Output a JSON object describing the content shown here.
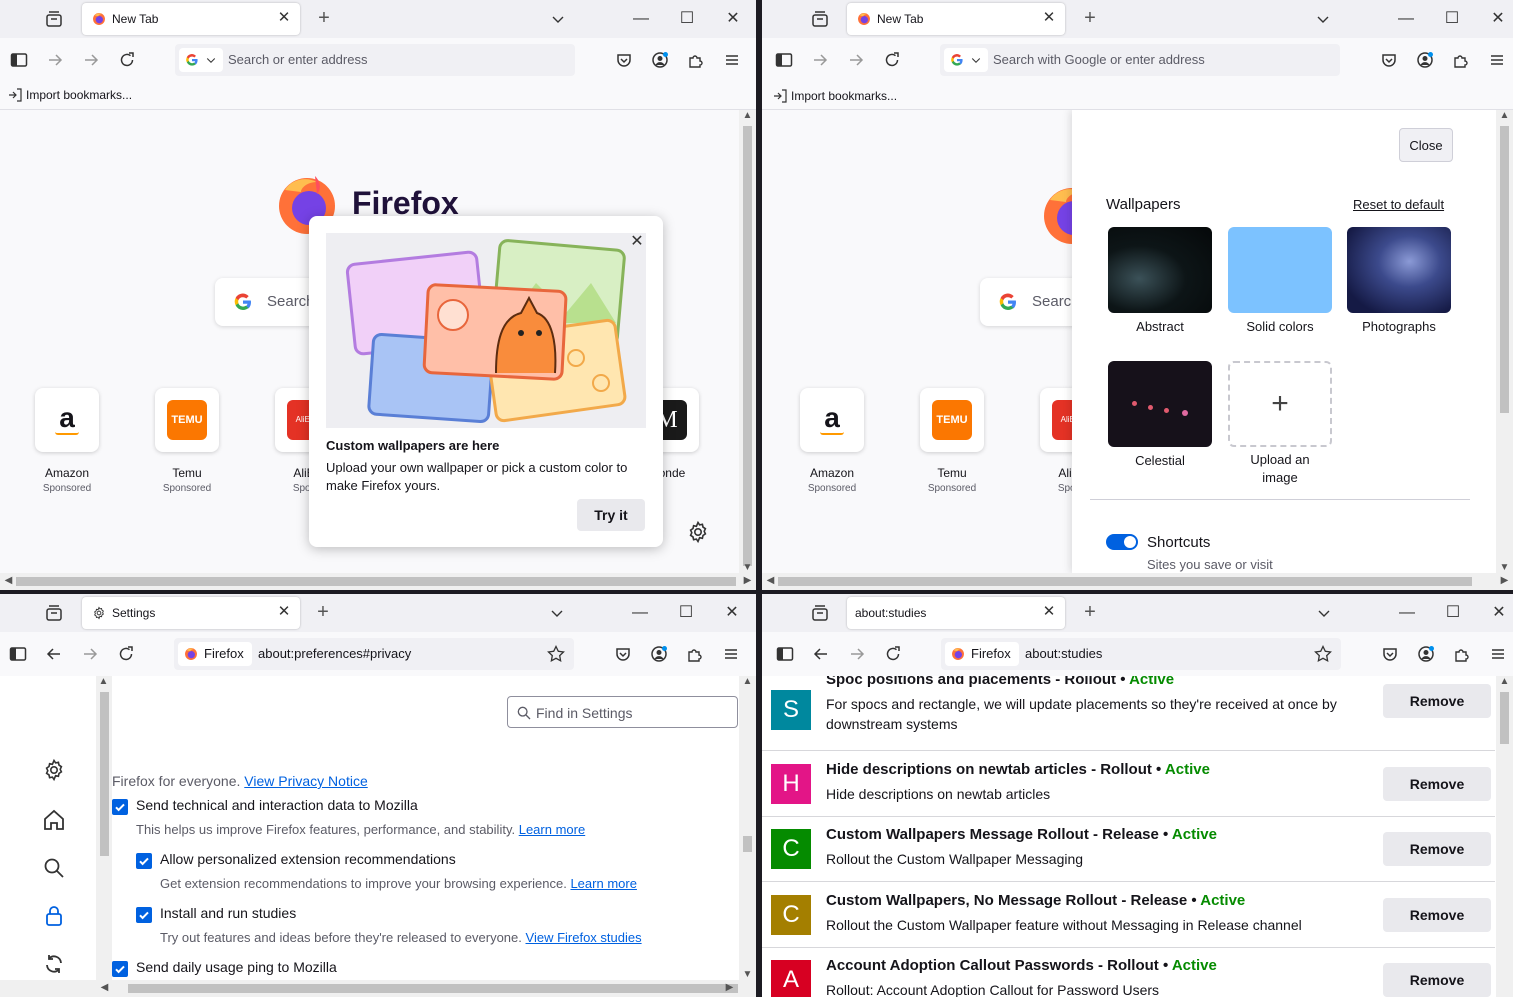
{
  "colors": {
    "accent": "#0061e0",
    "active": "#058b00"
  },
  "icons": {
    "tablist": "tab-list-icon",
    "sidebar": "sidebar-icon",
    "back": "back-arrow-icon",
    "forward": "forward-arrow-icon",
    "reload": "reload-icon",
    "pocket": "pocket-icon",
    "account": "account-icon",
    "extensions": "puzzle-icon",
    "menu": "hamburger-icon"
  },
  "window_controls": {
    "minimize": "—",
    "maximize": "☐",
    "close": "✕"
  },
  "win1": {
    "tab_title": "New Tab",
    "search_placeholder": "Search or enter address",
    "import_bookmarks": "Import bookmarks...",
    "brand": "Firefox",
    "page_search": "Search",
    "shortcuts": [
      {
        "name": "Amazon",
        "sponsored": "Sponsored"
      },
      {
        "name": "Temu",
        "sponsored": "Sponsored"
      },
      {
        "name": "AliEx",
        "sponsored": "Spons"
      },
      {
        "name": "Monde",
        "sponsored": ""
      }
    ],
    "popup": {
      "title": "Custom wallpapers are here",
      "body": "Upload your own wallpaper or pick a custom color to make Firefox yours.",
      "button": "Try it"
    }
  },
  "win2": {
    "tab_title": "New Tab",
    "search_placeholder": "Search with Google or enter address",
    "import_bookmarks": "Import bookmarks...",
    "page_search": "Search",
    "shortcuts": [
      {
        "name": "Amazon",
        "sponsored": "Sponsored"
      },
      {
        "name": "Temu",
        "sponsored": "Sponsored"
      },
      {
        "name": "AliEx",
        "sponsored": "Spons"
      }
    ],
    "panel": {
      "close": "Close",
      "wallpapers_heading": "Wallpapers",
      "reset": "Reset to default",
      "wallpapers": [
        "Abstract",
        "Solid colors",
        "Photographs",
        "Celestial",
        "Upload an image"
      ],
      "shortcuts_label": "Shortcuts",
      "shortcuts_desc": "Sites you save or visit",
      "shortcuts_enabled": true
    }
  },
  "win3": {
    "tab_title": "Settings",
    "identity": "Firefox",
    "url": "about:preferences#privacy",
    "find_placeholder": "Find in Settings",
    "intro_text": "Firefox for everyone.",
    "privacy_link": "View Privacy Notice",
    "items": [
      {
        "label": "Send technical and interaction data to Mozilla",
        "desc": "This helps us improve Firefox features, performance, and stability.",
        "link": "Learn more",
        "checked": true
      },
      {
        "label": "Allow personalized extension recommendations",
        "desc": "Get extension recommendations to improve your browsing experience.",
        "link": "Learn more",
        "checked": true
      },
      {
        "label": "Install and run studies",
        "desc": "Try out features and ideas before they're released to everyone.",
        "link": "View Firefox studies",
        "checked": true
      },
      {
        "label": "Send daily usage ping to Mozilla",
        "desc": "",
        "link": "",
        "checked": true
      }
    ]
  },
  "win4": {
    "tab_title": "about:studies",
    "identity": "Firefox",
    "url": "about:studies",
    "active_label": "Active",
    "remove_label": "Remove",
    "studies": [
      {
        "letter": "S",
        "color": "#00889e",
        "title": "Spoc positions and placements - Rollout",
        "desc": "For spocs and rectangle, we will update placements so they're received at once by downstream systems"
      },
      {
        "letter": "H",
        "color": "#e31587",
        "title": "Hide descriptions on newtab articles - Rollout",
        "desc": "Hide descriptions on newtab articles"
      },
      {
        "letter": "C",
        "color": "#058b00",
        "title": "Custom Wallpapers Message Rollout - Release",
        "desc": "Rollout the Custom Wallpaper Messaging"
      },
      {
        "letter": "C",
        "color": "#a47f00",
        "title": "Custom Wallpapers, No Message Rollout - Release",
        "desc": "Rollout the Custom Wallpaper feature without Messaging in Release channel"
      },
      {
        "letter": "A",
        "color": "#d70022",
        "title": "Account Adoption Callout Passwords - Rollout",
        "desc": "Rollout: Account Adoption Callout for Password Users"
      }
    ]
  }
}
